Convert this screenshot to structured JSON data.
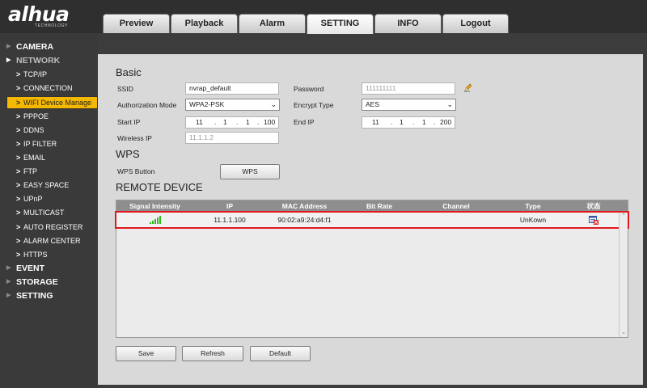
{
  "header": {
    "logo": "alhua",
    "logo_tagline": "TECHNOLOGY",
    "tabs": [
      {
        "label": "Preview"
      },
      {
        "label": "Playback"
      },
      {
        "label": "Alarm"
      },
      {
        "label": "SETTING"
      },
      {
        "label": "INFO"
      },
      {
        "label": "Logout"
      }
    ],
    "active_tab": "SETTING"
  },
  "sidebar": {
    "items": [
      {
        "label": "CAMERA",
        "level": 0
      },
      {
        "label": "NETWORK",
        "level": 0,
        "expanded": true
      },
      {
        "label": "TCP/IP",
        "level": 1
      },
      {
        "label": "CONNECTION",
        "level": 1
      },
      {
        "label": "WIFI Device Manage",
        "level": 1,
        "active": true
      },
      {
        "label": "PPPOE",
        "level": 1
      },
      {
        "label": "DDNS",
        "level": 1
      },
      {
        "label": "IP FILTER",
        "level": 1
      },
      {
        "label": "EMAIL",
        "level": 1
      },
      {
        "label": "FTP",
        "level": 1
      },
      {
        "label": "EASY SPACE",
        "level": 1
      },
      {
        "label": "UPnP",
        "level": 1
      },
      {
        "label": "MULTICAST",
        "level": 1
      },
      {
        "label": "AUTO REGISTER",
        "level": 1
      },
      {
        "label": "ALARM CENTER",
        "level": 1
      },
      {
        "label": "HTTPS",
        "level": 1
      },
      {
        "label": "EVENT",
        "level": 0
      },
      {
        "label": "STORAGE",
        "level": 0
      },
      {
        "label": "SETTING",
        "level": 0
      }
    ],
    "sub_arrow": ">"
  },
  "basic": {
    "title": "Basic",
    "ssid_label": "SSID",
    "ssid_value": "nvrap_default",
    "password_label": "Password",
    "password_value": "111111111",
    "auth_label": "Authorization Mode",
    "auth_value": "WPA2-PSK",
    "encrypt_label": "Encrypt Type",
    "encrypt_value": "AES",
    "start_ip_label": "Start IP",
    "start_ip": [
      "11",
      "1",
      "1",
      "100"
    ],
    "end_ip_label": "End IP",
    "end_ip": [
      "11",
      "1",
      "1",
      "200"
    ],
    "wireless_ip_label": "Wireless IP",
    "wireless_ip_value": "11.1.1.2",
    "ip_dot": "."
  },
  "wps": {
    "title": "WPS",
    "button_label": "WPS Button",
    "button_text": "WPS"
  },
  "remote": {
    "title": "REMOTE DEVICE",
    "columns": [
      "Signal Intensity",
      "IP",
      "MAC Address",
      "Bit Rate",
      "Channel",
      "Type",
      "状态"
    ],
    "rows": [
      {
        "signal": "full",
        "ip": "11.1.1.100",
        "mac": "90:02:a9:24:d4:f1",
        "bit_rate": "",
        "channel": "",
        "type": "UnKown"
      }
    ]
  },
  "actions": {
    "save": "Save",
    "refresh": "Refresh",
    "default": "Default"
  },
  "icons": {
    "edit": "pencil-icon",
    "status": "device-status-icon",
    "signal": "wifi-signal-icon"
  },
  "colors": {
    "active_nav": "#f5b800",
    "signal": "#33bb22",
    "row_highlight": "#e0191f",
    "table_header": "#8e8e8e"
  }
}
